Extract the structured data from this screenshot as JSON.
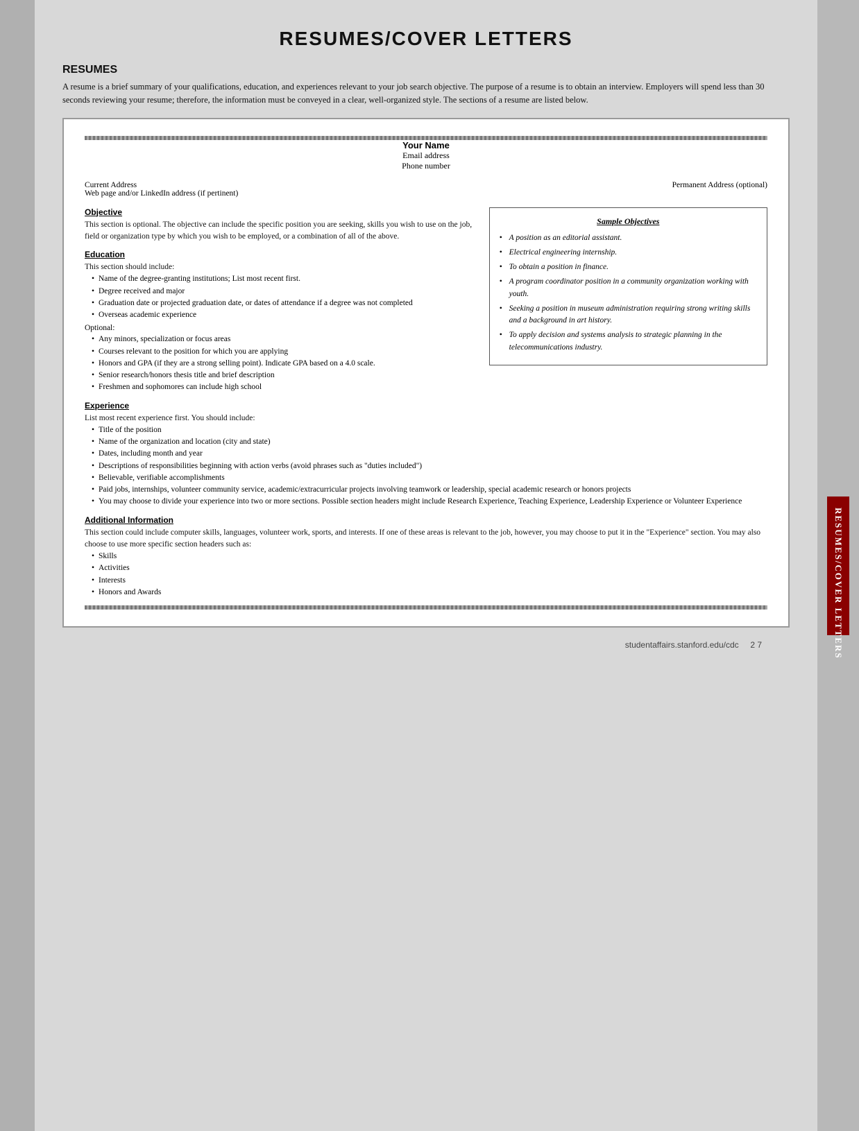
{
  "page": {
    "title": "RESUMES/COVER LETTERS",
    "footer": {
      "url": "studentaffairs.stanford.edu/cdc",
      "page": "2 7"
    }
  },
  "resumes_section": {
    "heading": "RESUMES",
    "intro": "A resume is a brief summary of your qualifications, education, and experiences relevant to your job search objective. The purpose of a resume is to obtain an interview. Employers will spend less than 30 seconds reviewing your resume; therefore, the information must be conveyed in a clear, well-organized style. The sections of a resume are listed below."
  },
  "resume_template": {
    "name": "Your Name",
    "email": "Email address",
    "phone": "Phone number",
    "current_address_label": "Current Address",
    "current_address_sub": "Web page and/or LinkedIn address (if pertinent)",
    "permanent_address_label": "Permanent Address (optional)",
    "sections": {
      "objective": {
        "title": "Objective",
        "text": "This section is optional. The objective can include the specific position you are seeking, skills you wish to use on the job, field or organization type by which you wish to be employed, or a combination of all of the above."
      },
      "education": {
        "title": "Education",
        "intro": "This section should include:",
        "items": [
          "Name of the degree-granting institutions; List most recent first.",
          "Degree received and major",
          "Graduation date or projected graduation date, or dates of attendance if a degree was not completed",
          "Overseas academic experience"
        ],
        "optional_label": "Optional:",
        "optional_items": [
          "Any minors, specialization or focus areas",
          "Courses relevant to the position for which you are applying",
          "Honors and GPA (if they are a strong selling point). Indicate GPA based on a 4.0 scale.",
          "Senior research/honors thesis title and brief description",
          "Freshmen and sophomores can include high school"
        ]
      },
      "experience": {
        "title": "Experience",
        "intro": "List most recent experience first. You should include:",
        "items": [
          "Title of the position",
          "Name of the organization and location (city and state)",
          "Dates, including month and year",
          "Descriptions of responsibilities beginning with action verbs (avoid phrases such as \"duties included\")",
          "Believable, verifiable accomplishments",
          "Paid jobs, internships, volunteer community service, academic/extracurricular projects involving teamwork or leadership, special academic research or honors projects",
          "You may choose to divide your experience into two or more sections. Possible section headers might include Research Experience, Teaching Experience, Leadership Experience or Volunteer Experience"
        ]
      },
      "additional_information": {
        "title": "Additional Information",
        "text": "This section could include computer skills, languages, volunteer work, sports, and interests. If one of these areas is relevant to the job, however, you may choose to put it in the \"Experience\" section. You may also choose to use more specific section headers such as:",
        "items": [
          "Skills",
          "Activities",
          "Interests",
          "Honors and Awards"
        ]
      }
    }
  },
  "sample_objectives": {
    "title": "Sample Objectives",
    "items": [
      "A position as an editorial assistant.",
      "Electrical engineering internship.",
      "To obtain a position in finance.",
      "A program coordinator position in a community organization working with youth.",
      "Seeking a position in museum administration requiring strong writing skills and a background in art history.",
      "To apply decision and systems analysis to strategic planning in the telecommunications industry."
    ]
  },
  "sidebar": {
    "label": "RESUMES/COVER LETTERS"
  }
}
